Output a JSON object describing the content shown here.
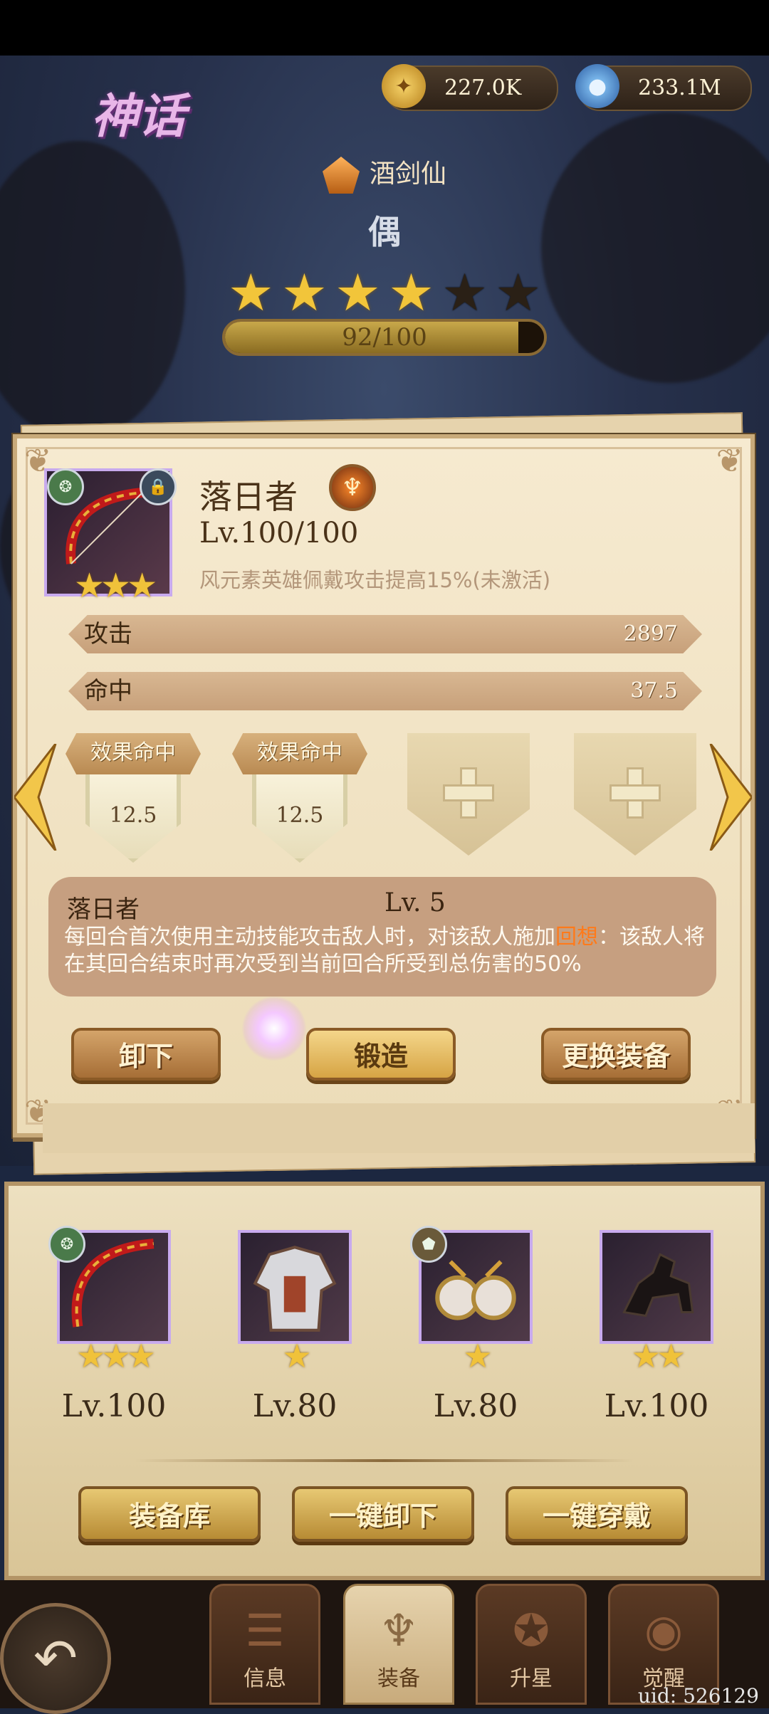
{
  "header": {
    "rarity": "神话",
    "resources": [
      {
        "icon": "coin-icon",
        "value": "227.0K"
      },
      {
        "icon": "potion-icon",
        "value": "233.1M"
      }
    ]
  },
  "hero": {
    "name": "酒剑仙",
    "class": "偶",
    "stars_filled": 4,
    "stars_total": 6,
    "progress_text": "92/100",
    "progress_fraction": 0.92
  },
  "item": {
    "name": "落日者",
    "level": "Lv.100/100",
    "description": "风元素英雄佩戴攻击提高15%(未激活)",
    "stars": "★★★",
    "stats": [
      {
        "label": "攻击",
        "value": "2897"
      },
      {
        "label": "命中",
        "value": "37.5"
      }
    ],
    "substats": [
      {
        "label": "效果命中",
        "value": "12.5"
      },
      {
        "label": "效果命中",
        "value": "12.5"
      }
    ],
    "skill": {
      "name": "落日者",
      "level": "Lv. 5",
      "desc_before": "每回合首次使用主动技能攻击敌人时，对该敌人施加",
      "desc_highlight": "回想",
      "desc_after": "：该敌人将在其回合结束时再次受到当前回合所受到总伤害的50%"
    },
    "buttons": {
      "unequip": "卸下",
      "forge": "锻造",
      "replace": "更换装备"
    }
  },
  "equipment": [
    {
      "stars": "★★★",
      "level": "Lv.100"
    },
    {
      "stars": "★",
      "level": "Lv.80"
    },
    {
      "stars": "★",
      "level": "Lv.80"
    },
    {
      "stars": "★★",
      "level": "Lv.100"
    }
  ],
  "board_buttons": {
    "storage": "装备库",
    "unequip_all": "一键卸下",
    "equip_all": "一键穿戴"
  },
  "nav": {
    "tabs": [
      {
        "label": "信息",
        "icon": "info-icon"
      },
      {
        "label": "装备",
        "icon": "equipment-icon"
      },
      {
        "label": "升星",
        "icon": "star-up-icon"
      },
      {
        "label": "觉醒",
        "icon": "awaken-icon"
      }
    ],
    "active": 1
  },
  "uid": "uid: 526129",
  "colors": {
    "accent_gold": "#f2c53a",
    "panel_bg": "#f6ead0",
    "highlight": "#ff7a1a"
  }
}
